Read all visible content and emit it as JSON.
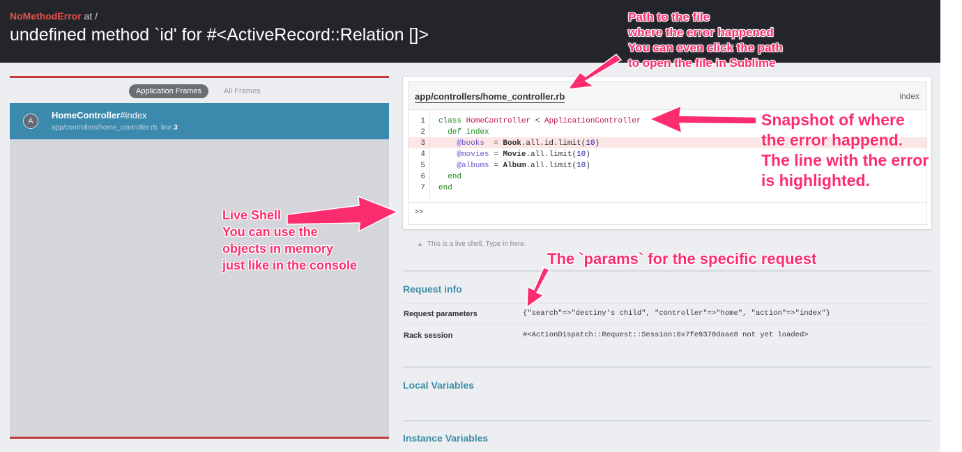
{
  "header": {
    "error_class": "NoMethodError",
    "at_text": " at /",
    "message": "undefined method `id' for #<ActiveRecord::Relation []>"
  },
  "frames_panel": {
    "tabs": [
      "Application Frames",
      "All Frames"
    ],
    "active_tab": "Application Frames",
    "frame": {
      "badge": "A",
      "class_name": "HomeController",
      "method": "#index",
      "file": "app/controllers/home_controller.rb, line ",
      "line": "3"
    }
  },
  "code": {
    "file_path": "app/controllers/home_controller.rb",
    "method": "index",
    "highlighted_line": 3,
    "line_numbers": [
      "1",
      "2",
      "3",
      "4",
      "5",
      "6",
      "7"
    ],
    "lines": [
      "class HomeController < ApplicationController",
      "  def index",
      "    @books  = Book.all.id.limit(10)",
      "    @movies = Movie.all.limit(10)",
      "    @albums = Album.all.limit(10)",
      "  end",
      "end"
    ],
    "shell_prompt": ">>",
    "shell_hint": "This is a live shell. Type in here."
  },
  "request_info": {
    "title": "Request info",
    "rows": [
      {
        "label": "Request parameters",
        "value": "{\"search\"=>\"destiny's child\", \"controller\"=>\"home\", \"action\"=>\"index\"}"
      },
      {
        "label": "Rack session",
        "value": "#<ActionDispatch::Request::Session:0x7fe9370daae8 not yet loaded>"
      }
    ]
  },
  "local_variables": {
    "title": "Local Variables"
  },
  "instance_variables": {
    "title": "Instance Variables"
  },
  "annotations": {
    "path_note": [
      "Path to the file",
      "where the error happened",
      "You can even click the path",
      "to open the file in Sublime"
    ],
    "snapshot_note": [
      "Snapshot of where",
      "the error happend.",
      "The line with the error",
      "is highlighted."
    ],
    "shell_note": [
      "Live Shell",
      "You can use the",
      "objects in memory",
      "just like in the console"
    ],
    "params_note": [
      "The `params` for the specific request"
    ]
  },
  "colors": {
    "header_bg": "#23252b",
    "error_red": "#e8504b",
    "frame_selected": "#3b89ad",
    "section_title": "#3c8da7",
    "annotation_pink": "#fb2d6e",
    "error_line_bg": "#fde6e6"
  }
}
